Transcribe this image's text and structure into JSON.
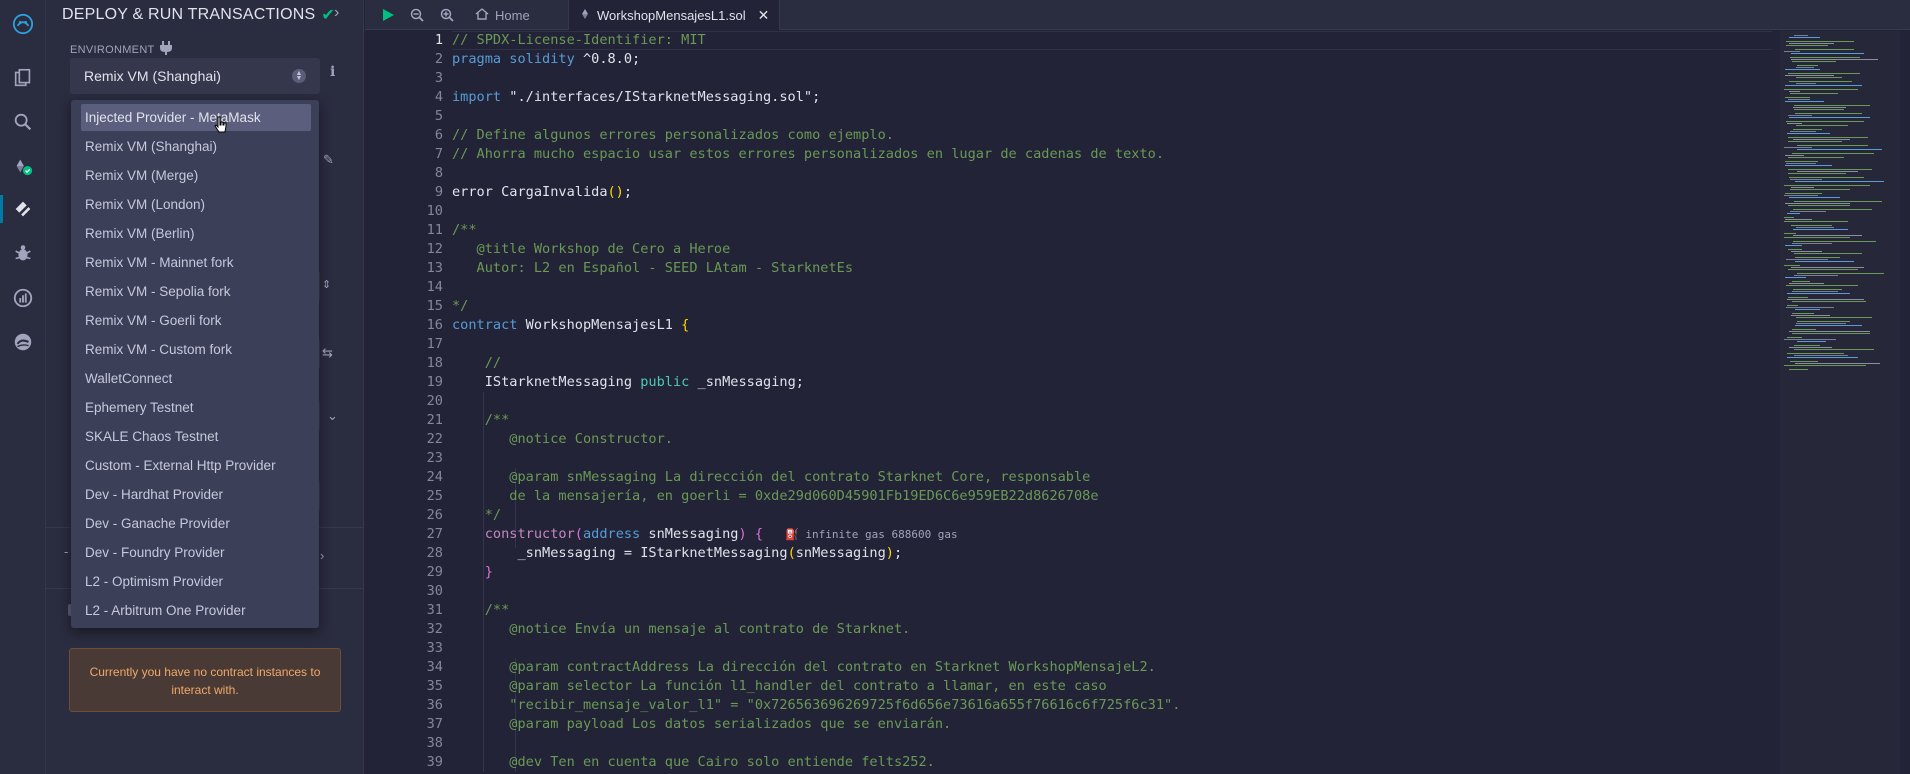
{
  "panel": {
    "title": "DEPLOY & RUN TRANSACTIONS",
    "environment_label": "ENVIRONMENT",
    "environment_value": "Remix VM (Shanghai)",
    "notice": "Currently you have no contract instances to interact with."
  },
  "dropdown": {
    "options": [
      "Injected Provider - MetaMask",
      "Remix VM (Shanghai)",
      "Remix VM (Merge)",
      "Remix VM (London)",
      "Remix VM (Berlin)",
      "Remix VM - Mainnet fork",
      "Remix VM - Sepolia fork",
      "Remix VM - Goerli fork",
      "Remix VM - Custom fork",
      "WalletConnect",
      "Ephemery Testnet",
      "SKALE Chaos Testnet",
      "Custom - External Http Provider",
      "Dev - Hardhat Provider",
      "Dev - Ganache Provider",
      "Dev - Foundry Provider",
      "L2 - Optimism Provider",
      "L2 - Arbitrum One Provider"
    ],
    "highlighted": "Injected Provider - MetaMask"
  },
  "tabs": {
    "home": "Home",
    "file": "WorkshopMensajesL1.sol"
  },
  "editor": {
    "current_line": 1,
    "line_numbers": [
      "1",
      "2",
      "3",
      "4",
      "5",
      "6",
      "7",
      "8",
      "9",
      "10",
      "11",
      "12",
      "13",
      "14",
      "15",
      "16",
      "17",
      "18",
      "19",
      "20",
      "21",
      "22",
      "23",
      "24",
      "25",
      "26",
      "27",
      "28",
      "29",
      "30",
      "31",
      "32",
      "33",
      "34",
      "35",
      "36",
      "37",
      "38",
      "39"
    ],
    "lines": {
      "l1": "// SPDX-License-Identifier: MIT",
      "l2_kw": "pragma solidity",
      "l2_rest": " ^0.8.0;",
      "l4_kw": "import",
      "l4_rest": " \"./interfaces/IStarknetMessaging.sol\";",
      "l6": "// Define algunos errores personalizados como ejemplo.",
      "l7": "// Ahorra mucho espacio usar estos errores personalizados en lugar de cadenas de texto.",
      "l9_a": "error CargaInvalida",
      "l9_b": "()",
      "l9_c": ";",
      "l11": "/**",
      "l12": "   @title Workshop de Cero a Heroe",
      "l13": "   Autor: L2 en Español - SEED LAtam - StarknetEs",
      "l15": "*/",
      "l16_kw": "contract",
      "l16_name": " WorkshopMensajesL1 ",
      "l16_brace": "{",
      "l18": "    //",
      "l19_a": "    IStarknetMessaging ",
      "l19_kw": "public",
      "l19_b": " _snMessaging;",
      "l21": "    /**",
      "l22": "       @notice Constructor.",
      "l24": "       @param snMessaging La dirección del contrato Starknet Core, responsable",
      "l25": "       de la mensajería, en goerli = 0xde29d060D45901Fb19ED6C6e959EB22d8626708e",
      "l26": "    */",
      "l27_kw": "    constructor",
      "l27_p1": "(",
      "l27_addr": "address",
      "l27_arg": " snMessaging",
      "l27_p2": ")",
      "l27_brace": " {",
      "l27_gas": "infinite gas 688600 gas",
      "l28_a": "        _snMessaging = IStarknetMessaging",
      "l28_p1": "(",
      "l28_arg": "snMessaging",
      "l28_p2": ")",
      "l28_c": ";",
      "l29": "    }",
      "l31": "    /**",
      "l32": "       @notice Envía un mensaje al contrato de Starknet.",
      "l34": "       @param contractAddress La dirección del contrato en Starknet WorkshopMensajeL2.",
      "l35": "       @param selector La función l1_handler del contrato a llamar, en este caso",
      "l36": "       \"recibir_mensaje_valor_l1\" = \"0x726563696269725f6d656e73616a655f76616c6f725f6c31\".",
      "l37": "       @param payload Los datos serializados que se enviarán.",
      "l39": "       @dev Ten en cuenta que Cairo solo entiende felts252."
    }
  },
  "colors": {
    "background": "#222336",
    "panel": "#2a2c3f",
    "accent": "#007aa6",
    "success": "#00bf7f",
    "comment": "#6a9955",
    "keyword": "#569cd6",
    "warning_text": "#f0a96a"
  },
  "icons": [
    "remix-logo-icon",
    "file-explorer-icon",
    "search-icon",
    "solidity-compiler-icon",
    "deploy-run-icon",
    "debugger-icon",
    "analytics-icon",
    "starknet-icon",
    "check-icon",
    "chevron-right-icon",
    "plug-icon",
    "info-icon",
    "run-icon",
    "zoom-out-icon",
    "zoom-in-icon",
    "home-icon",
    "file-icon",
    "close-icon",
    "gas-icon",
    "cursor-icon"
  ]
}
